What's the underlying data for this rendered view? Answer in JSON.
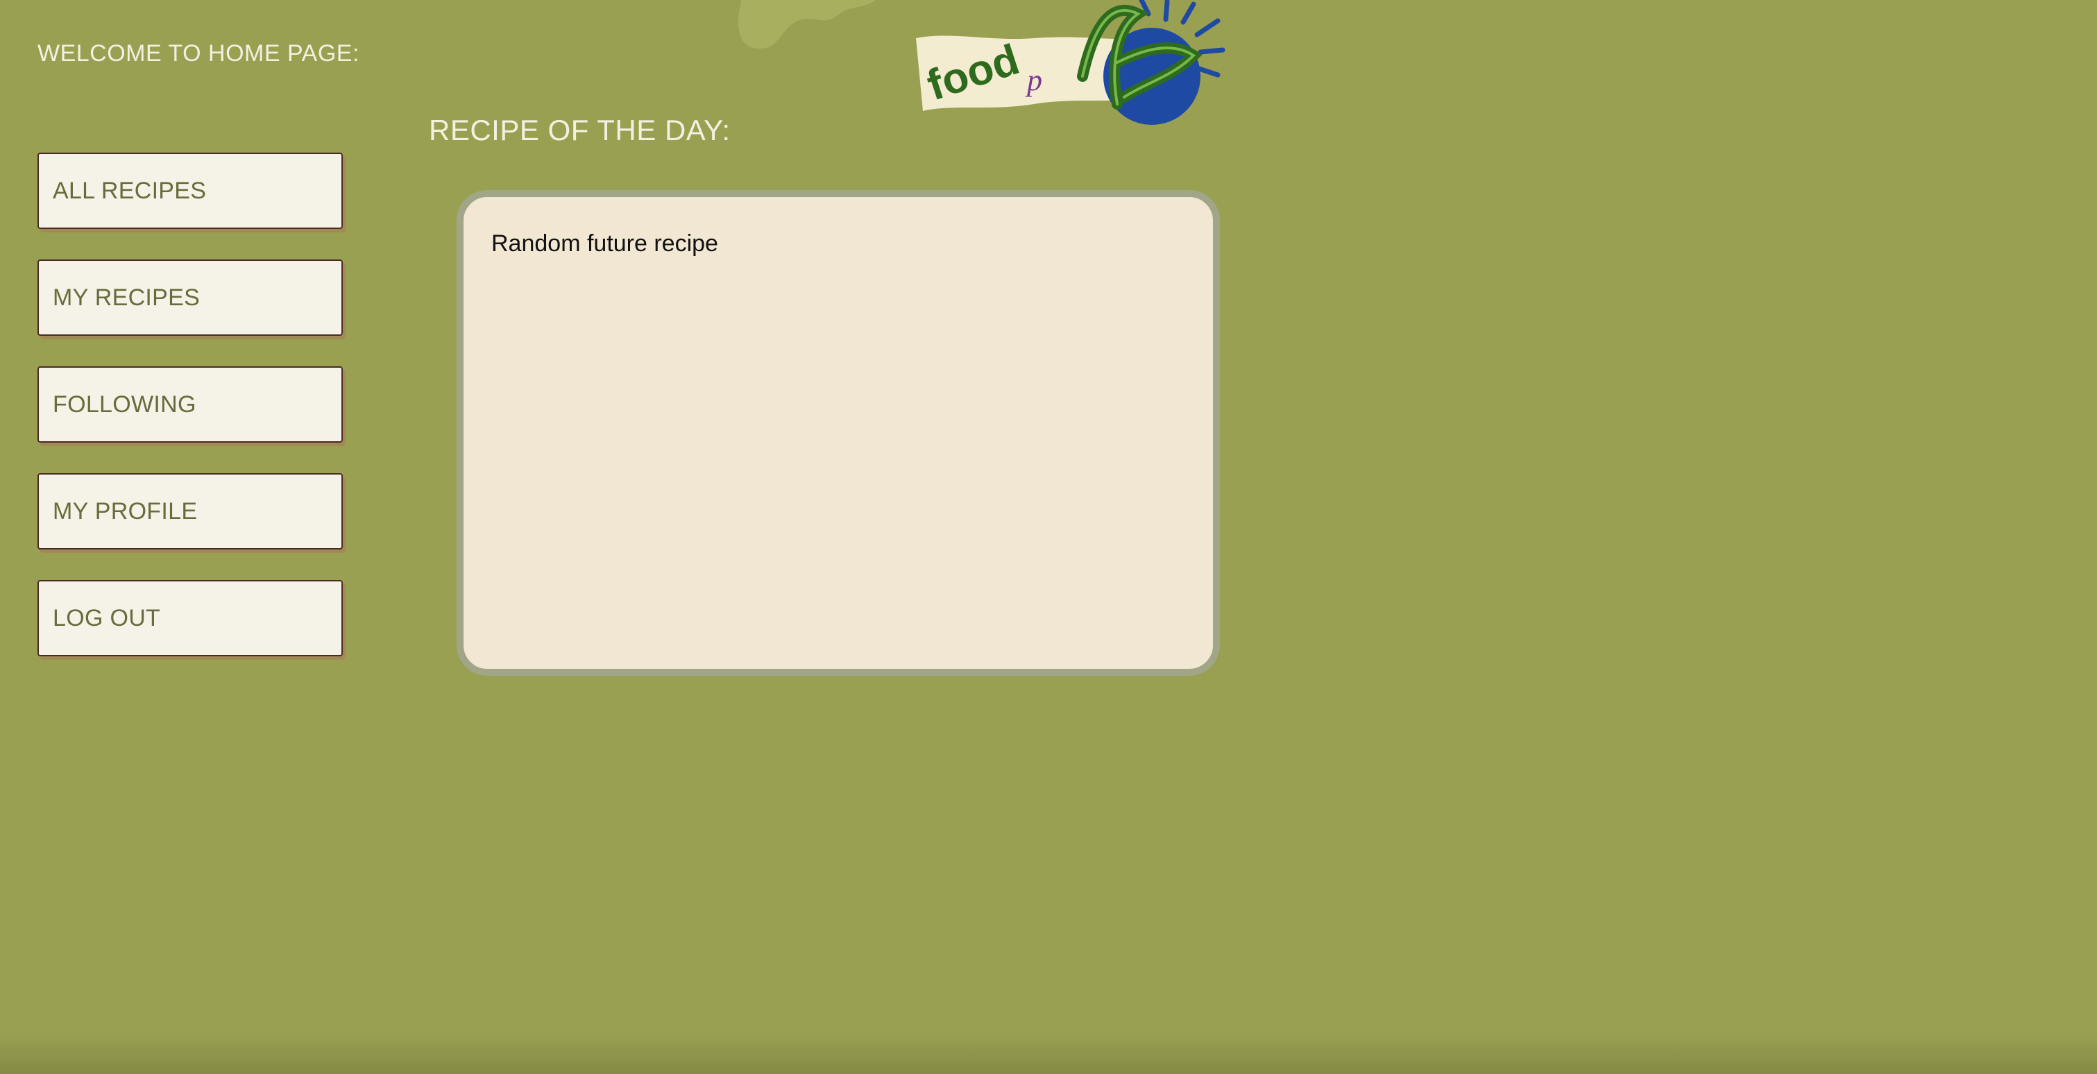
{
  "header": {
    "welcome_text": "WELCOME TO HOME PAGE:",
    "logo_text": "foodpals"
  },
  "sidebar": {
    "items": [
      {
        "label": "ALL RECIPES"
      },
      {
        "label": "MY RECIPES"
      },
      {
        "label": "FOLLOWING"
      },
      {
        "label": "MY PROFILE"
      },
      {
        "label": "LOG OUT"
      }
    ]
  },
  "main": {
    "section_title": "RECIPE OF THE DAY:",
    "recipe_card": {
      "text": "Random future recipe"
    }
  },
  "colors": {
    "background": "#9aa052",
    "button_bg": "#f5f3e7",
    "button_text": "#6a6a3c",
    "card_bg": "#f2e7d2",
    "card_border": "#a1a688",
    "logo_green": "#2e6b1e",
    "logo_blue": "#1f4aa3"
  },
  "icons": {
    "logo": "foodpals-logo"
  }
}
